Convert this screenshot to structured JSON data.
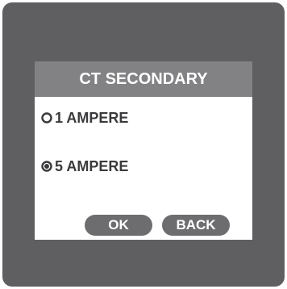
{
  "screen": {
    "title": "CT SECONDARY",
    "options": [
      {
        "label": "1 AMPERE",
        "selected": false
      },
      {
        "label": "5 AMPERE",
        "selected": true
      }
    ],
    "buttons": {
      "ok_label": "OK",
      "back_label": "BACK"
    }
  },
  "colors": {
    "bezel": "#5f5f61",
    "title_bar": "#828284",
    "button": "#6d6d6f",
    "text": "#3a3a3c"
  },
  "icons": {
    "option_unselected": "radio-unselected-icon",
    "option_selected": "radio-selected-icon"
  }
}
